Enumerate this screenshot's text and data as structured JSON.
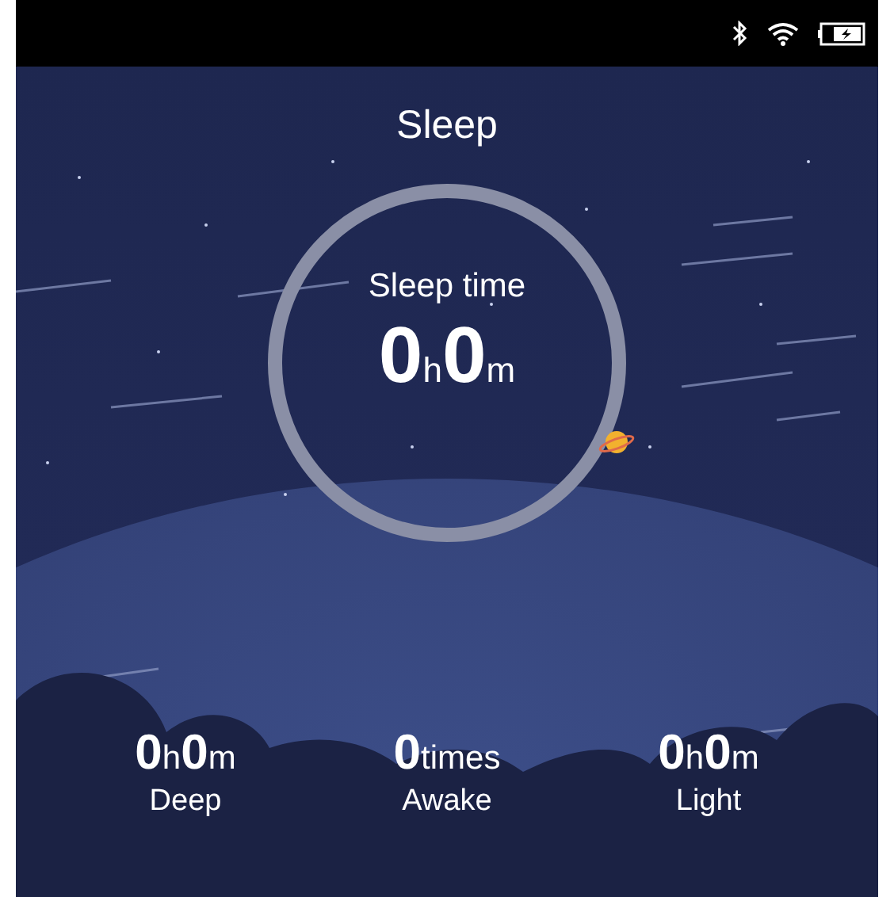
{
  "status_bar": {
    "bluetooth": true,
    "wifi": true,
    "charging": true
  },
  "title": "Sleep",
  "sleep_time": {
    "label": "Sleep time",
    "value": "0$_{h}$0$_{m}$"
  },
  "stats": [
    {
      "label": "Deep",
      "value": "0$_{h}$0$_{m}$"
    },
    {
      "label": "Awake",
      "value": "0$_{times}$"
    },
    {
      "label": "Light",
      "value": "0$_{h}$0$_{m}$"
    }
  ]
}
